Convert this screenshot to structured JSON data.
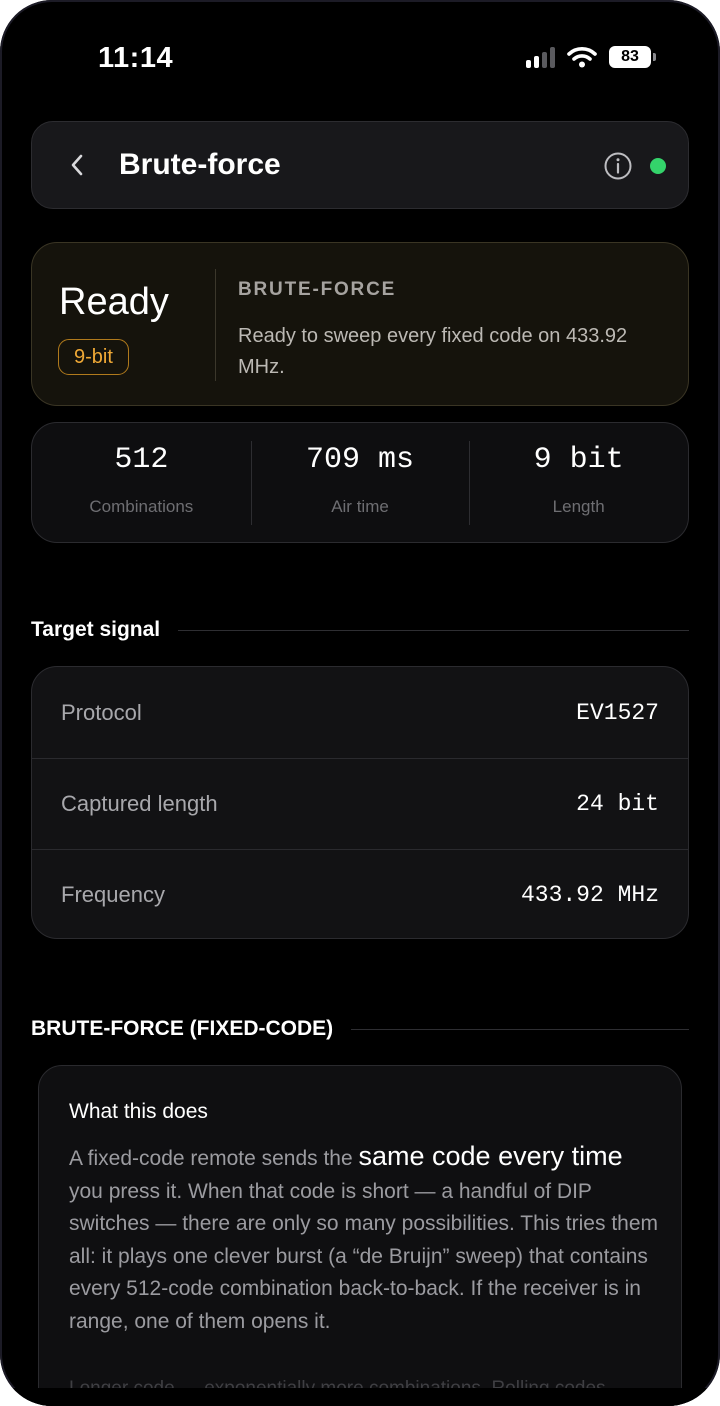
{
  "status_bar": {
    "time": "11:14",
    "battery": "83",
    "icons": [
      "signal-icon",
      "wifi-icon",
      "battery-icon"
    ]
  },
  "header": {
    "title": "Brute-force",
    "back_icon": "chevron-left-icon",
    "info_icon": "info-icon",
    "live_color": "#34d36b"
  },
  "status_card": {
    "state": "Ready",
    "badge": "9-bit",
    "kicker": "BRUTE-FORCE",
    "description": "Ready to sweep every fixed code on 433.92 MHz.",
    "accent_color": "#f0a936"
  },
  "stats": [
    {
      "value": "512",
      "label": "Combinations"
    },
    {
      "value": "709 ms",
      "label": "Air time"
    },
    {
      "value": "9 bit",
      "label": "Length"
    }
  ],
  "target": {
    "title": "Target signal",
    "rows": [
      {
        "key": "Protocol",
        "value": "EV1527"
      },
      {
        "key": "Captured length",
        "value": "24 bit"
      },
      {
        "key": "Frequency",
        "value": "433.92 MHz"
      }
    ]
  },
  "info": {
    "section_title": "BRUTE-FORCE (FIXED-CODE)",
    "title": "What this does",
    "body_before": "A fixed-code remote sends the ",
    "body_emphasis": "same code every time",
    "body_after": " you press it. When that code is short — a handful of DIP switches — there are only so many possibilities. This tries them all: it plays one clever burst (a “de Bruijn” sweep) that contains every 512-code combination back-to-back. If the receiver is in range, one of them opens it.",
    "footnote": "Longer code → exponentially more combinations. Rolling codes"
  }
}
